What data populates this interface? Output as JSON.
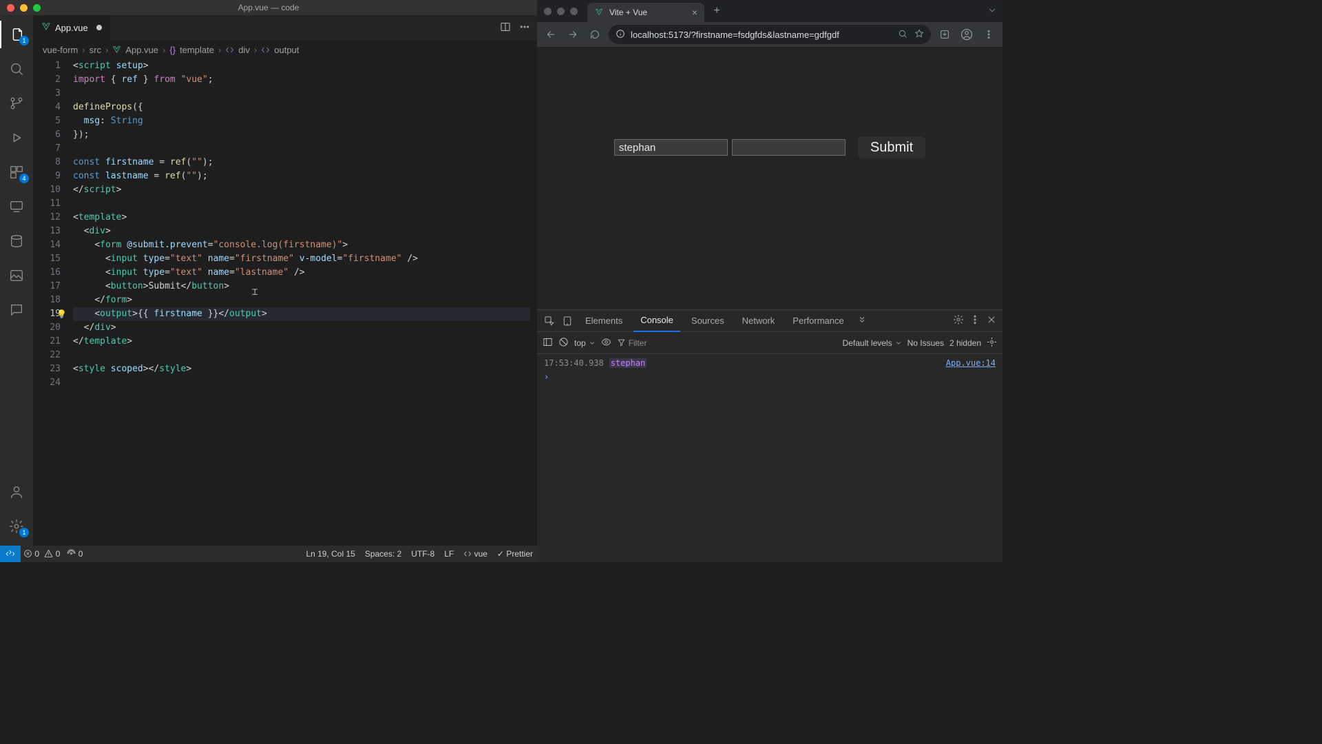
{
  "vscode": {
    "window_title": "App.vue — code",
    "activity_badges": {
      "explorer": "1",
      "extensions": "4",
      "settings": "1"
    },
    "tab": {
      "label": "App.vue"
    },
    "breadcrumb": [
      "vue-form",
      "src",
      "App.vue",
      "template",
      "div",
      "output"
    ],
    "cursor_line": 19,
    "code": [
      {
        "n": 1,
        "html": "<span class='tok-punct'>&lt;</span><span class='tok-tag'>script</span> <span class='tok-attr'>setup</span><span class='tok-punct'>&gt;</span>"
      },
      {
        "n": 2,
        "html": "<span class='tok-kw'>import</span> <span class='tok-punct'>{ </span><span class='tok-var'>ref</span><span class='tok-punct'> }</span> <span class='tok-kw'>from</span> <span class='tok-str'>\"vue\"</span><span class='tok-punct'>;</span>"
      },
      {
        "n": 3,
        "html": ""
      },
      {
        "n": 4,
        "html": "<span class='tok-fn'>defineProps</span><span class='tok-punct'>({</span>"
      },
      {
        "n": 5,
        "html": "  <span class='tok-var'>msg</span><span class='tok-punct'>:</span> <span class='tok-blue'>String</span>"
      },
      {
        "n": 6,
        "html": "<span class='tok-punct'>});</span>"
      },
      {
        "n": 7,
        "html": ""
      },
      {
        "n": 8,
        "html": "<span class='tok-const'>const</span> <span class='tok-var'>firstname</span> <span class='tok-punct'>=</span> <span class='tok-fn'>ref</span><span class='tok-punct'>(</span><span class='tok-str'>\"\"</span><span class='tok-punct'>);</span>"
      },
      {
        "n": 9,
        "html": "<span class='tok-const'>const</span> <span class='tok-var'>lastname</span> <span class='tok-punct'>=</span> <span class='tok-fn'>ref</span><span class='tok-punct'>(</span><span class='tok-str'>\"\"</span><span class='tok-punct'>);</span>"
      },
      {
        "n": 10,
        "html": "<span class='tok-punct'>&lt;/</span><span class='tok-tag'>script</span><span class='tok-punct'>&gt;</span>"
      },
      {
        "n": 11,
        "html": ""
      },
      {
        "n": 12,
        "html": "<span class='tok-punct'>&lt;</span><span class='tok-tag'>template</span><span class='tok-punct'>&gt;</span>"
      },
      {
        "n": 13,
        "html": "  <span class='tok-punct'>&lt;</span><span class='tok-tag'>div</span><span class='tok-punct'>&gt;</span>"
      },
      {
        "n": 14,
        "html": "    <span class='tok-punct'>&lt;</span><span class='tok-tag'>form</span> <span class='tok-attr'>@submit.prevent</span><span class='tok-punct'>=</span><span class='tok-str'>\"console.log(firstname)\"</span><span class='tok-punct'>&gt;</span>"
      },
      {
        "n": 15,
        "html": "      <span class='tok-punct'>&lt;</span><span class='tok-tag'>input</span> <span class='tok-attr'>type</span><span class='tok-punct'>=</span><span class='tok-str'>\"text\"</span> <span class='tok-attr'>name</span><span class='tok-punct'>=</span><span class='tok-str'>\"firstname\"</span> <span class='tok-attr'>v-model</span><span class='tok-punct'>=</span><span class='tok-str'>\"firstname\"</span> <span class='tok-punct'>/&gt;</span>"
      },
      {
        "n": 16,
        "html": "      <span class='tok-punct'>&lt;</span><span class='tok-tag'>input</span> <span class='tok-attr'>type</span><span class='tok-punct'>=</span><span class='tok-str'>\"text\"</span> <span class='tok-attr'>name</span><span class='tok-punct'>=</span><span class='tok-str'>\"lastname\"</span> <span class='tok-punct'>/&gt;</span>"
      },
      {
        "n": 17,
        "html": "      <span class='tok-punct'>&lt;</span><span class='tok-tag'>button</span><span class='tok-punct'>&gt;</span><span class='tok-white'>Submit</span><span class='tok-punct'>&lt;/</span><span class='tok-tag'>button</span><span class='tok-punct'>&gt;</span>"
      },
      {
        "n": 18,
        "html": "    <span class='tok-punct'>&lt;/</span><span class='tok-tag'>form</span><span class='tok-punct'>&gt;</span>"
      },
      {
        "n": 19,
        "html": "    <span class='tok-punct'>&lt;</span><span class='tok-tag'>output</span><span class='tok-punct'>&gt;</span><span class='tok-punct'>{{ </span><span class='tok-var'>firstname</span><span class='tok-punct'> }}</span><span class='tok-punct'>&lt;/</span><span class='tok-tag'>output</span><span class='tok-punct'>&gt;</span>",
        "bulb": true
      },
      {
        "n": 20,
        "html": "  <span class='tok-punct'>&lt;/</span><span class='tok-tag'>div</span><span class='tok-punct'>&gt;</span>"
      },
      {
        "n": 21,
        "html": "<span class='tok-punct'>&lt;/</span><span class='tok-tag'>template</span><span class='tok-punct'>&gt;</span>"
      },
      {
        "n": 22,
        "html": ""
      },
      {
        "n": 23,
        "html": "<span class='tok-punct'>&lt;</span><span class='tok-tag'>style</span> <span class='tok-attr'>scoped</span><span class='tok-punct'>&gt;&lt;/</span><span class='tok-tag'>style</span><span class='tok-punct'>&gt;</span>"
      },
      {
        "n": 24,
        "html": ""
      }
    ],
    "status": {
      "errors": "0",
      "warnings": "0",
      "ports": "0",
      "cursor": "Ln 19, Col 15",
      "spaces": "Spaces: 2",
      "encoding": "UTF-8",
      "eol": "LF",
      "lang": "vue",
      "prettier": "Prettier"
    }
  },
  "chrome": {
    "tab_title": "Vite + Vue",
    "url": "localhost:5173/?firstname=fsdgfds&lastname=gdfgdf",
    "form": {
      "firstname_value": "stephan",
      "lastname_value": "",
      "submit_label": "Submit"
    },
    "devtools": {
      "tabs": [
        "Elements",
        "Console",
        "Sources",
        "Network",
        "Performance"
      ],
      "active_tab": "Console",
      "context": "top",
      "filter_placeholder": "Filter",
      "levels": "Default levels",
      "issues": "No Issues",
      "hidden": "2 hidden",
      "log": {
        "ts": "17:53:40.938",
        "msg": "stephan",
        "src": "App.vue:14"
      }
    }
  }
}
